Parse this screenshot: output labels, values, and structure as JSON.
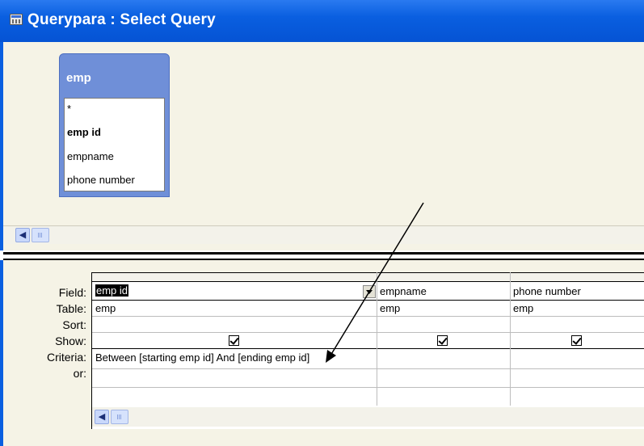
{
  "window": {
    "title": "Querypara : Select Query",
    "icon": "query-window-icon"
  },
  "table_pane": {
    "field_list": {
      "title": "emp",
      "fields": [
        "*",
        "emp id",
        "empname",
        "phone number"
      ],
      "bold_field": "emp id"
    }
  },
  "design_grid": {
    "row_labels": [
      "Field:",
      "Table:",
      "Sort:",
      "Show:",
      "Criteria:",
      "or:"
    ],
    "columns": [
      {
        "field": "emp id",
        "table": "emp",
        "sort": "",
        "show": true,
        "criteria": "Between [starting emp id] And [ending emp id]",
        "or": "",
        "selected": true
      },
      {
        "field": "empname",
        "table": "emp",
        "sort": "",
        "show": true,
        "criteria": "",
        "or": ""
      },
      {
        "field": "phone number",
        "table": "emp",
        "sort": "",
        "show": true,
        "criteria": "",
        "or": ""
      }
    ]
  },
  "colors": {
    "title_bar": "#0a5fe0",
    "pane_background": "#f5f3e6",
    "field_list_header": "#6f8fd8",
    "annotation_arrow": "#000000"
  }
}
